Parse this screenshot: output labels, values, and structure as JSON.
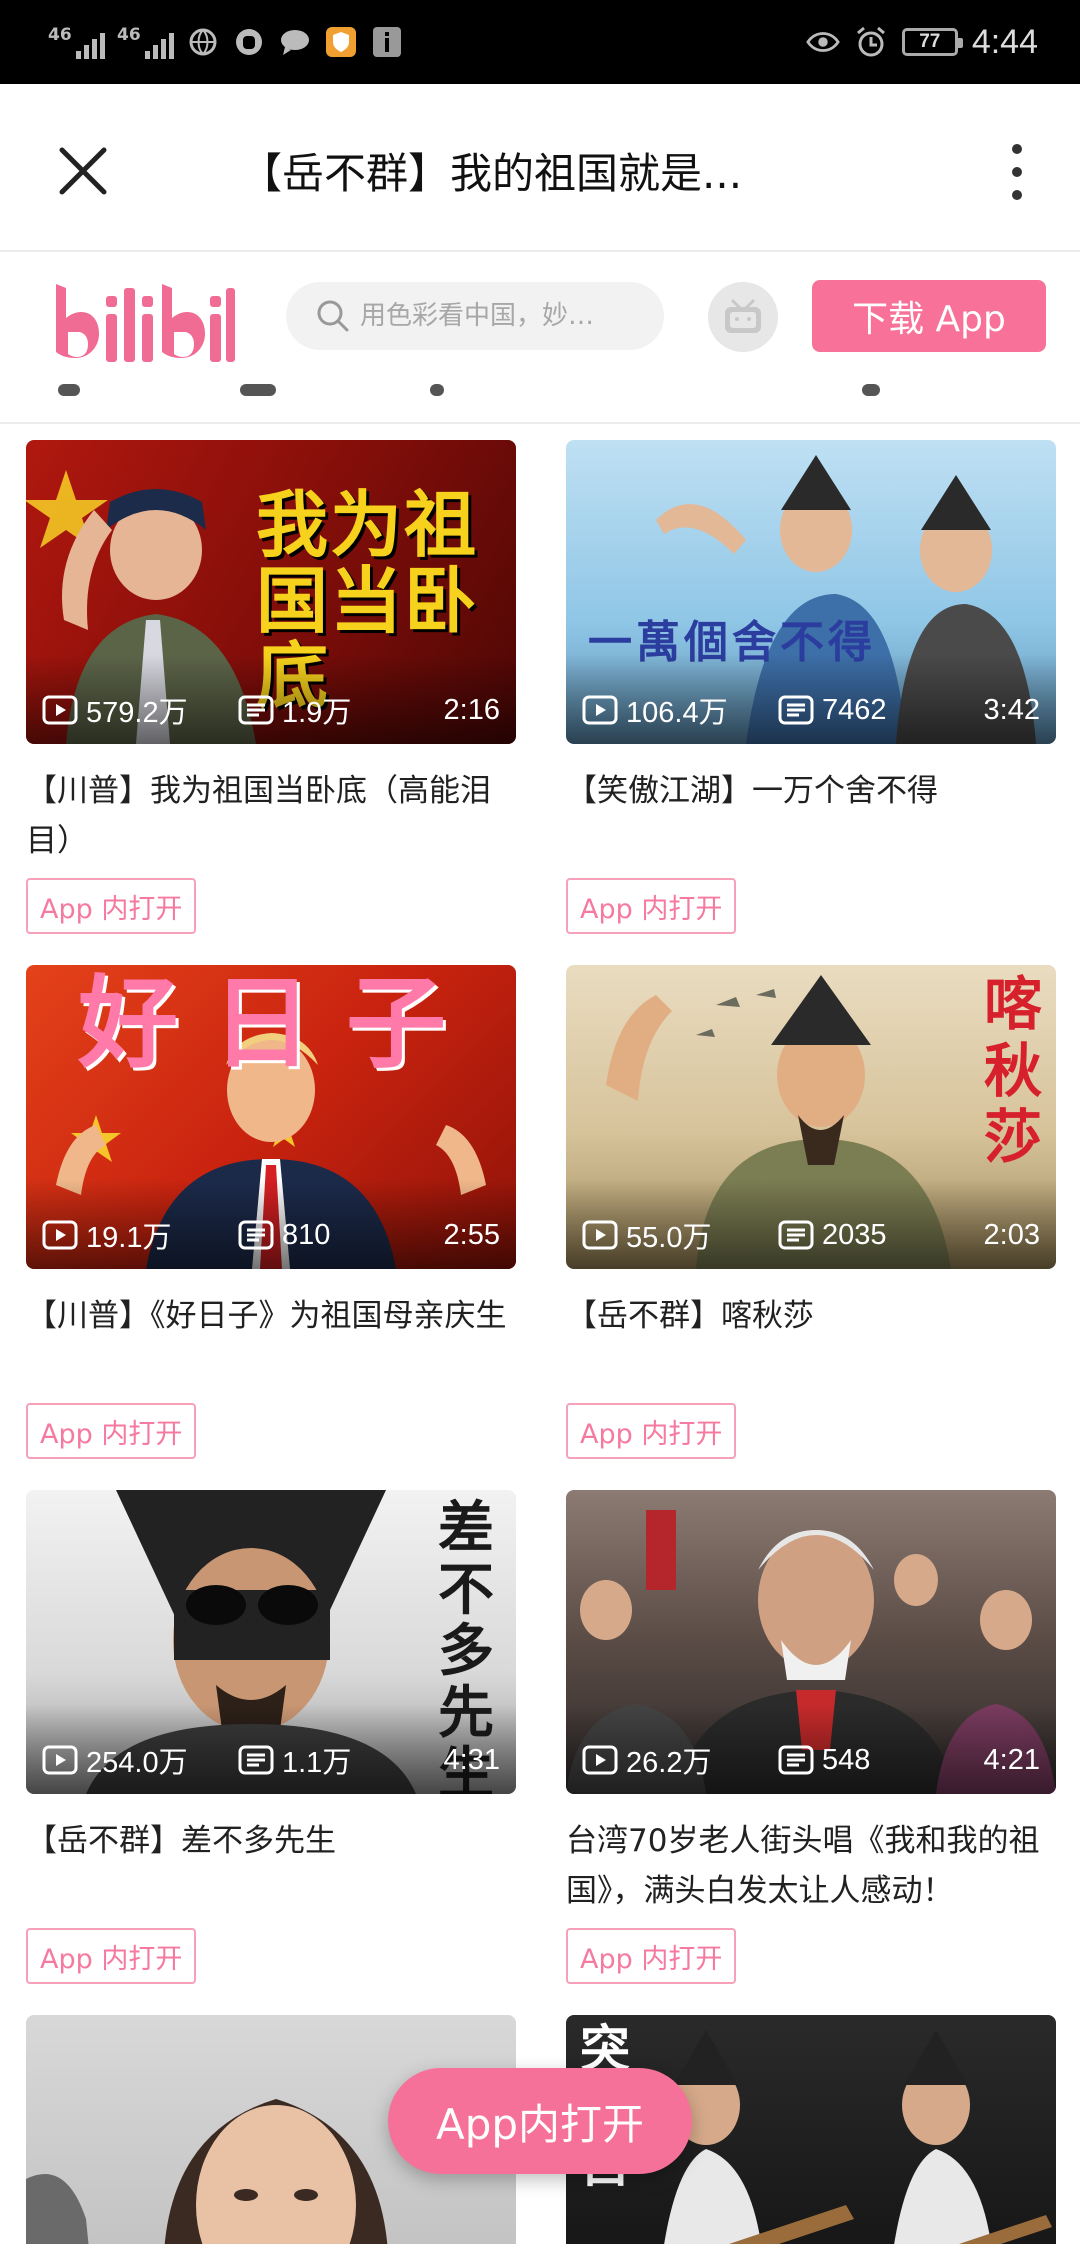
{
  "status_bar": {
    "network_1": "46",
    "network_2": "46",
    "battery": "77",
    "time": "4:44"
  },
  "titlebar": {
    "title": "【岳不群】我的祖国就是..."
  },
  "header": {
    "logo_text": "bilibili",
    "search_placeholder": "用色彩看中国，妙…",
    "download_label": "下载 App",
    "brand_color": "#f77198"
  },
  "videos": [
    {
      "thumb_text": "我为祖国当卧底",
      "views": "579.2万",
      "danmaku": "1.9万",
      "duration": "2:16",
      "title": "【川普】我为祖国当卧底（高能泪目）",
      "open_label": "App 内打开"
    },
    {
      "thumb_text": "一萬個舍不得",
      "views": "106.4万",
      "danmaku": "7462",
      "duration": "3:42",
      "title": "【笑傲江湖】一万个舍不得",
      "open_label": "App 内打开"
    },
    {
      "thumb_text": "好日子",
      "views": "19.1万",
      "danmaku": "810",
      "duration": "2:55",
      "title": "【川普】《好日子》为祖国母亲庆生",
      "open_label": "App 内打开"
    },
    {
      "thumb_text": "喀秋莎",
      "views": "55.0万",
      "danmaku": "2035",
      "duration": "2:03",
      "title": "【岳不群】喀秋莎",
      "open_label": "App 内打开"
    },
    {
      "thumb_text": "差不多先生",
      "views": "254.0万",
      "danmaku": "1.1万",
      "duration": "4:31",
      "title": "【岳不群】差不多先生",
      "open_label": "App 内打开"
    },
    {
      "thumb_text": "",
      "views": "26.2万",
      "danmaku": "548",
      "duration": "4:21",
      "title": "台湾70岁老人街头唱《我和我的祖国》，满头白发太让人感动！",
      "open_label": "App 内打开"
    },
    {
      "thumb_text": ""
    },
    {
      "thumb_text": "突的自"
    }
  ],
  "float_button": {
    "label": "App内打开"
  }
}
